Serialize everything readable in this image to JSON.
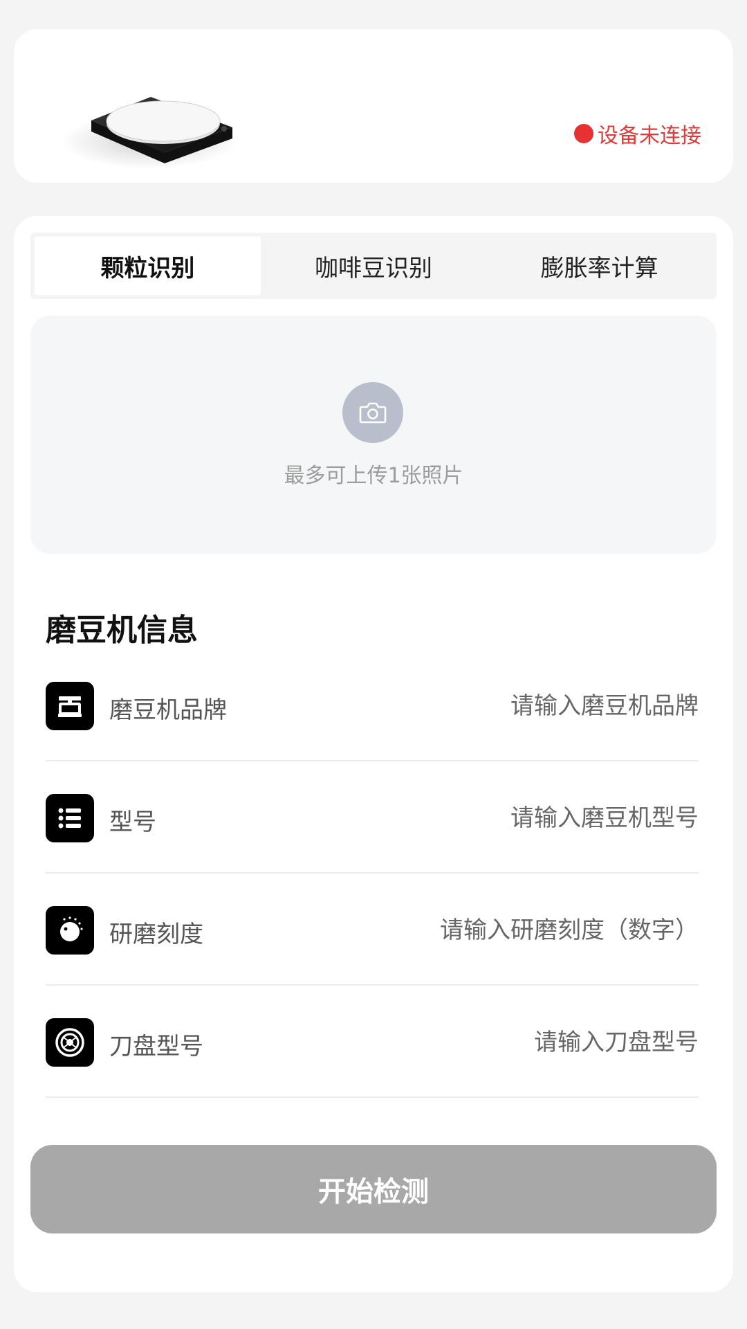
{
  "device": {
    "image_name": "coffee-scale-device",
    "status_text": "设备未连接",
    "status_color": "#e63232"
  },
  "tabs": [
    {
      "label": "颗粒识别",
      "active": true
    },
    {
      "label": "咖啡豆识别",
      "active": false
    },
    {
      "label": "膨胀率计算",
      "active": false
    }
  ],
  "upload": {
    "icon": "camera-icon",
    "hint": "最多可上传1张照片"
  },
  "grinder_section": {
    "title": "磨豆机信息",
    "rows": [
      {
        "icon": "grinder-icon",
        "label": "磨豆机品牌",
        "placeholder": "请输入磨豆机品牌",
        "value": ""
      },
      {
        "icon": "list-icon",
        "label": "型号",
        "placeholder": "请输入磨豆机型号",
        "value": ""
      },
      {
        "icon": "dial-icon",
        "label": "研磨刻度",
        "placeholder": "请输入研磨刻度（数字）",
        "value": ""
      },
      {
        "icon": "burr-icon",
        "label": "刀盘型号",
        "placeholder": "请输入刀盘型号",
        "value": ""
      }
    ]
  },
  "start_button": {
    "label": "开始检测",
    "enabled": false,
    "color": "#a8a8a8"
  }
}
